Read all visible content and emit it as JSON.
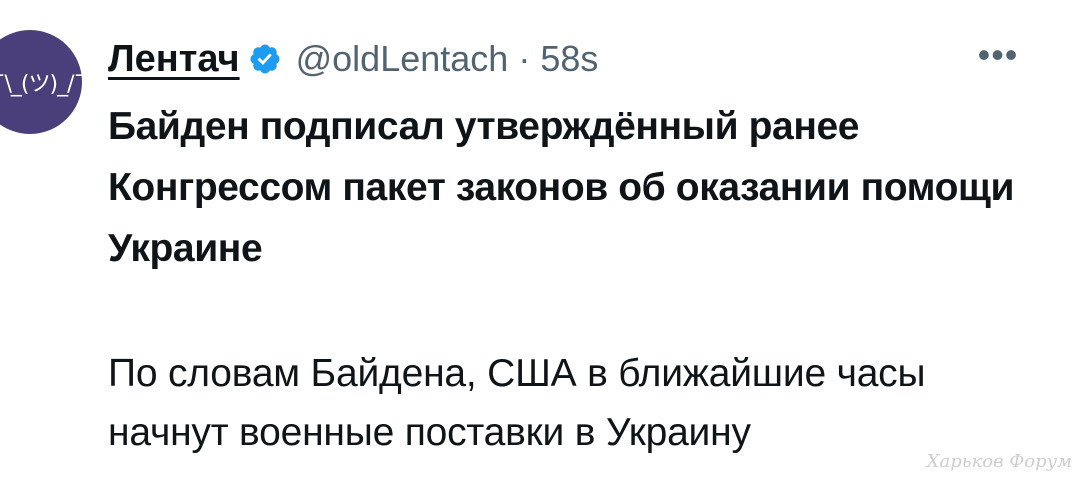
{
  "tweet": {
    "avatar_text": "¯\\_(ツ)_/¯",
    "display_name": "Лентач",
    "verified_icon": "verified-badge-icon",
    "handle": "@oldLentach",
    "separator": "·",
    "time": "58s",
    "more_icon": "more-horizontal-icon",
    "more_glyph": "•••",
    "headline": "Байден подписал утверждённый ранее Конгрессом пакет законов об оказании помощи Украине",
    "body": "По словам Байдена, США в ближайшие часы начнут военные поставки в Украину"
  },
  "watermark": "Харьков Форум",
  "colors": {
    "text_primary": "#0f1419",
    "text_secondary": "#536471",
    "verified_blue": "#1d9bf0",
    "avatar_bg": "#4a3f7a"
  }
}
